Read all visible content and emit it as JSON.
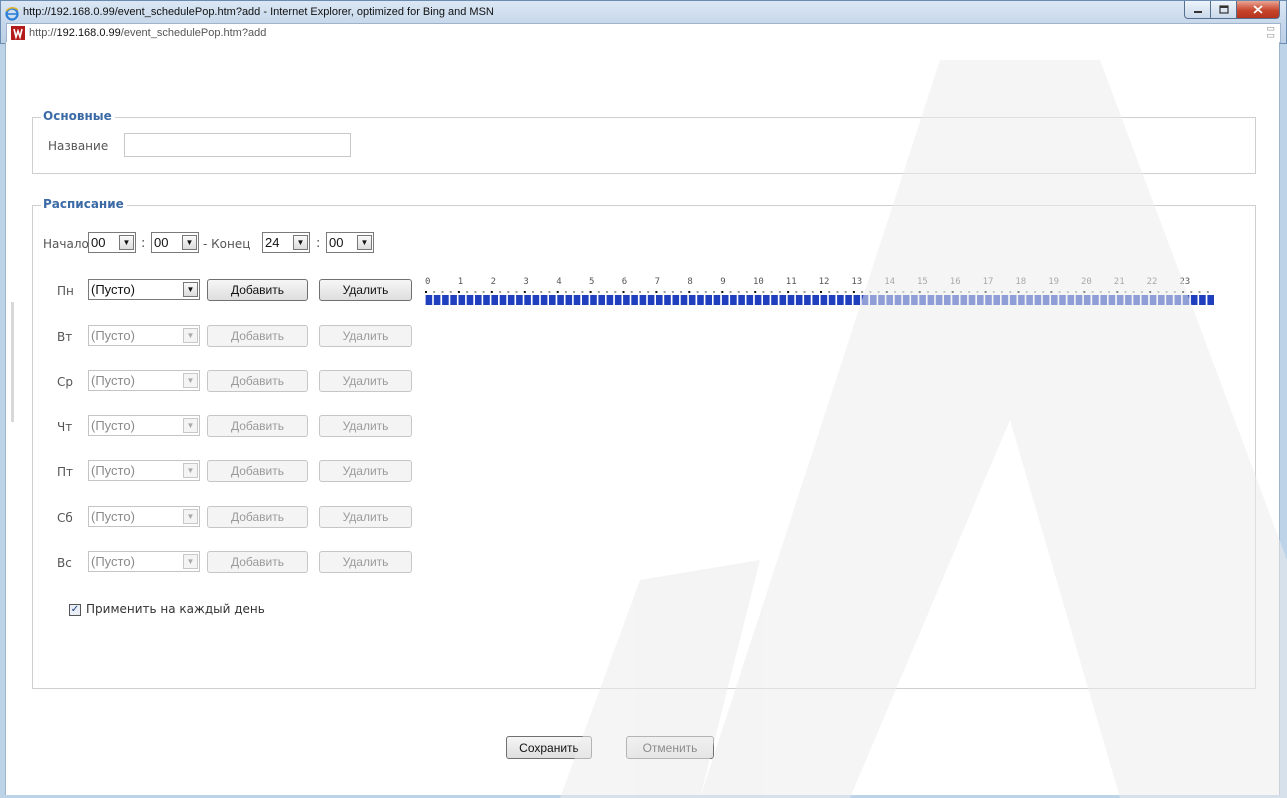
{
  "window": {
    "title": "http://192.168.0.99/event_schedulePop.htm?add - Internet Explorer, optimized for Bing and MSN",
    "address_prefix": "http://",
    "address_host": "192.168.0.99",
    "address_path": "/event_schedulePop.htm?add"
  },
  "basic": {
    "legend": "Основные",
    "name_label": "Название",
    "name_value": ""
  },
  "schedule": {
    "legend": "Расписание",
    "start_label": "Начало",
    "start_hour": "00",
    "start_min": "00",
    "end_label": "- Конец",
    "end_hour": "24",
    "end_min": "00",
    "colon": ":",
    "days": [
      {
        "label": "Пн",
        "select": "(Пусто)",
        "add": "Добавить",
        "delete": "Удалить",
        "enabled": true
      },
      {
        "label": "Вт",
        "select": "(Пусто)",
        "add": "Добавить",
        "delete": "Удалить",
        "enabled": false
      },
      {
        "label": "Ср",
        "select": "(Пусто)",
        "add": "Добавить",
        "delete": "Удалить",
        "enabled": false
      },
      {
        "label": "Чт",
        "select": "(Пусто)",
        "add": "Добавить",
        "delete": "Удалить",
        "enabled": false
      },
      {
        "label": "Пт",
        "select": "(Пусто)",
        "add": "Добавить",
        "delete": "Удалить",
        "enabled": false
      },
      {
        "label": "Сб",
        "select": "(Пусто)",
        "add": "Добавить",
        "delete": "Удалить",
        "enabled": false
      },
      {
        "label": "Вс",
        "select": "(Пусто)",
        "add": "Добавить",
        "delete": "Удалить",
        "enabled": false
      }
    ],
    "hours": [
      "0",
      "1",
      "2",
      "3",
      "4",
      "5",
      "6",
      "7",
      "8",
      "9",
      "10",
      "11",
      "12",
      "13",
      "14",
      "15",
      "16",
      "17",
      "18",
      "19",
      "20",
      "21",
      "22",
      "23"
    ],
    "apply_every_day_label": "Применить на каждый день",
    "apply_every_day_checked": true
  },
  "actions": {
    "save": "Сохранить",
    "cancel": "Отменить"
  },
  "colors": {
    "legend": "#3b6aa6",
    "timeline_bar": "#1f3fbf"
  }
}
